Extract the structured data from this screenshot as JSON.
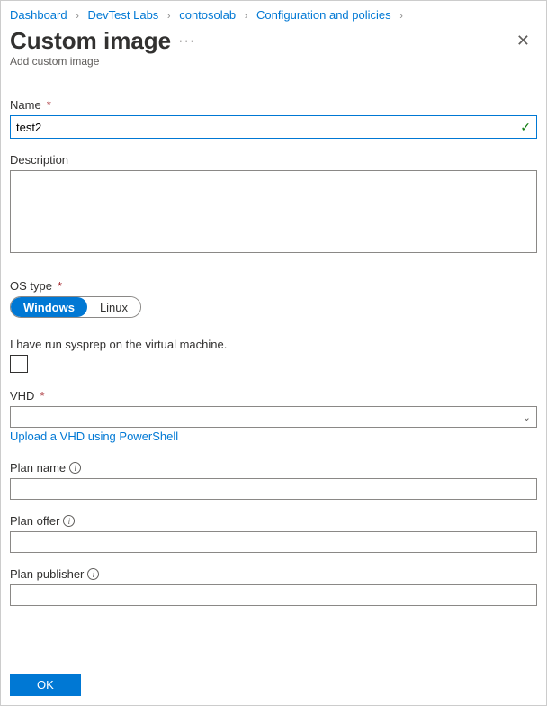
{
  "breadcrumb": [
    {
      "label": "Dashboard"
    },
    {
      "label": "DevTest Labs"
    },
    {
      "label": "contosolab"
    },
    {
      "label": "Configuration and policies"
    }
  ],
  "header": {
    "title": "Custom image",
    "subtitle": "Add custom image"
  },
  "fields": {
    "name": {
      "label": "Name",
      "value": "test2"
    },
    "description": {
      "label": "Description",
      "value": ""
    },
    "ostype": {
      "label": "OS type",
      "options": [
        "Windows",
        "Linux"
      ],
      "selected": "Windows"
    },
    "sysprep": {
      "label": "I have run sysprep on the virtual machine.",
      "checked": false
    },
    "vhd": {
      "label": "VHD",
      "value": "",
      "uploadLink": "Upload a VHD using PowerShell"
    },
    "planName": {
      "label": "Plan name",
      "value": ""
    },
    "planOffer": {
      "label": "Plan offer",
      "value": ""
    },
    "planPublisher": {
      "label": "Plan publisher",
      "value": ""
    }
  },
  "footer": {
    "ok": "OK"
  },
  "symbols": {
    "required": "*",
    "sep": "›"
  }
}
